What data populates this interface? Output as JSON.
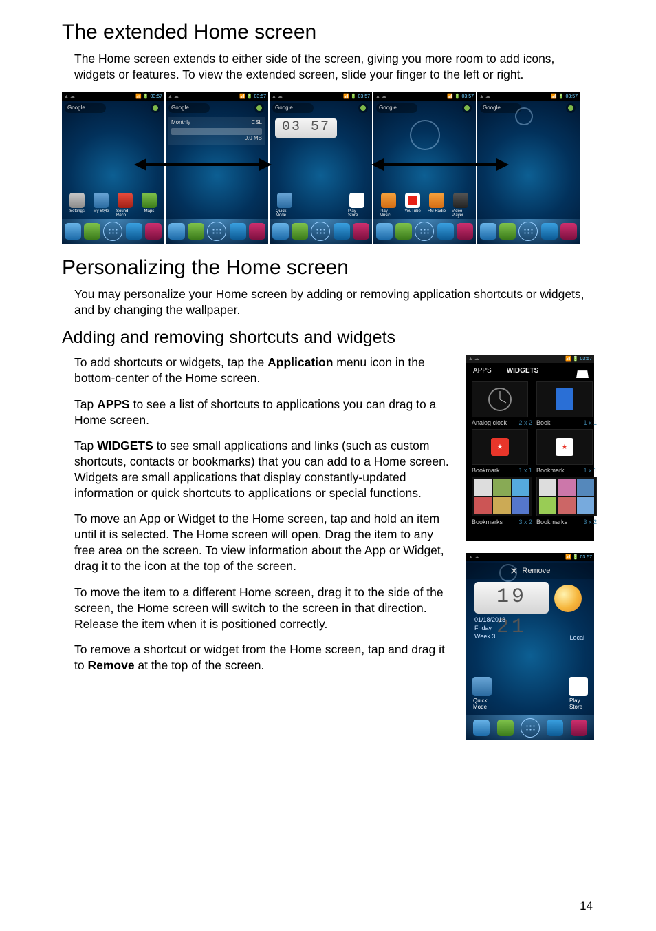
{
  "section1": {
    "heading": "The extended Home screen",
    "para": "The Home screen extends to either side of the screen, giving you more room to add icons, widgets or features. To view the extended screen, slide your finger to the left or right."
  },
  "status": {
    "icons": "▲ ☁",
    "time": "03:57",
    "signal": "📶 🔋"
  },
  "google": "Google",
  "monthly": {
    "label": "Monthly",
    "carrier": "CSL",
    "usage": "0.0 MB"
  },
  "clock_center": "03 57",
  "strip_apps": {
    "p1": [
      "Settings",
      "My Style",
      "Sound Reco.",
      "Maps"
    ],
    "p2": [
      "Quick Mode",
      "",
      "",
      "Play Store"
    ],
    "p3": [
      "Play Music",
      "YouTube",
      "FM Radio",
      "Video Player"
    ]
  },
  "section2": {
    "heading": "Personalizing the Home screen",
    "para": "You may personalize your Home screen by adding or removing application shortcuts or widgets, and by changing the wallpaper."
  },
  "section3": {
    "heading": "Adding and removing shortcuts and widgets",
    "p1a": "To add shortcuts or widgets, tap the ",
    "p1b": "Application",
    "p1c": " menu icon in the bottom-center of the Home screen.",
    "p2a": "Tap ",
    "p2b": "APPS",
    "p2c": " to see a list of shortcuts to applications you can drag to a Home screen.",
    "p3a": "Tap ",
    "p3b": "WIDGETS",
    "p3c": " to see small applications and links (such as custom shortcuts, contacts or bookmarks) that you can add to a Home screen. Widgets are small applications that display constantly-updated information or quick shortcuts to applications or special functions.",
    "p4": "To move an App or Widget to the Home screen, tap and hold an item until it is selected. The Home screen will open. Drag the item to any free area on the screen. To view information about the App or Widget, drag it to the icon at the top of the screen.",
    "p5": "To move the item to a different Home screen, drag it to the side of the screen, the Home screen will switch to the screen in that direction. Release the item when it is positioned correctly.",
    "p6a": "To remove a shortcut or widget from the Home screen, tap and drag it to ",
    "p6b": "Remove",
    "p6c": " at the top of the screen."
  },
  "widgets_screen": {
    "tab_apps": "APPS",
    "tab_widgets": "WIDGETS",
    "cells": [
      {
        "name": "Analog clock",
        "dim": "2 x 2"
      },
      {
        "name": "Book",
        "dim": "1 x 1"
      },
      {
        "name": "Bookmark",
        "dim": "1 x 1"
      },
      {
        "name": "Bookmark",
        "dim": "1 x 1"
      },
      {
        "name": "Bookmarks",
        "dim": "3 x 2"
      },
      {
        "name": "Bookmarks",
        "dim": "3 x 2"
      }
    ]
  },
  "remove_screen": {
    "remove": "Remove",
    "clock": "19 21",
    "date1": "01/18/2013",
    "date2": "Friday",
    "date3": "Week 3",
    "local": "Local",
    "app_left": "Quick Mode",
    "app_right": "Play Store"
  },
  "page_number": "14"
}
